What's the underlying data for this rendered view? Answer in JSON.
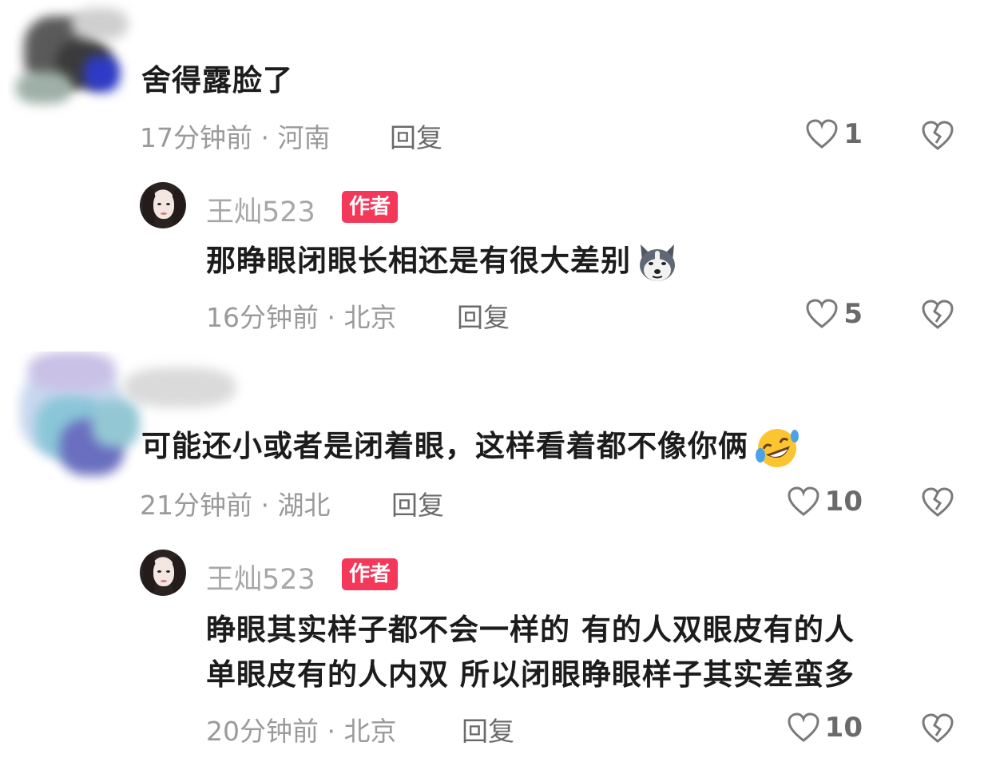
{
  "comments": [
    {
      "text": "舍得露脸了",
      "time": "17分钟前 · 河南",
      "reply_label": "回复",
      "likes": "1",
      "icons": {
        "like": "heart-outline-icon",
        "dislike": "broken-heart-icon"
      },
      "reply": {
        "author": "王灿523",
        "badge": "作者",
        "text": "那睁眼闭眼长相还是有很大差别",
        "emoji": "husky-dog-emoji",
        "time": "16分钟前 · 北京",
        "reply_label": "回复",
        "likes": "5"
      }
    },
    {
      "text": "可能还小或者是闭着眼，这样看着都不像你俩",
      "emoji": "rolling-laughing-emoji",
      "time": "21分钟前 · 湖北",
      "reply_label": "回复",
      "likes": "10",
      "reply": {
        "author": "王灿523",
        "badge": "作者",
        "text_line1": "睁眼其实样子都不会一样的 有的人双眼皮有的人",
        "text_line2": "单眼皮有的人内双 所以闭眼睁眼样子其实差蛮多",
        "time": "20分钟前 · 北京",
        "reply_label": "回复",
        "likes": "10"
      }
    }
  ],
  "colors": {
    "badge": "#f3385a",
    "meta": "#9a9a9a",
    "text": "#1c1c1c"
  }
}
